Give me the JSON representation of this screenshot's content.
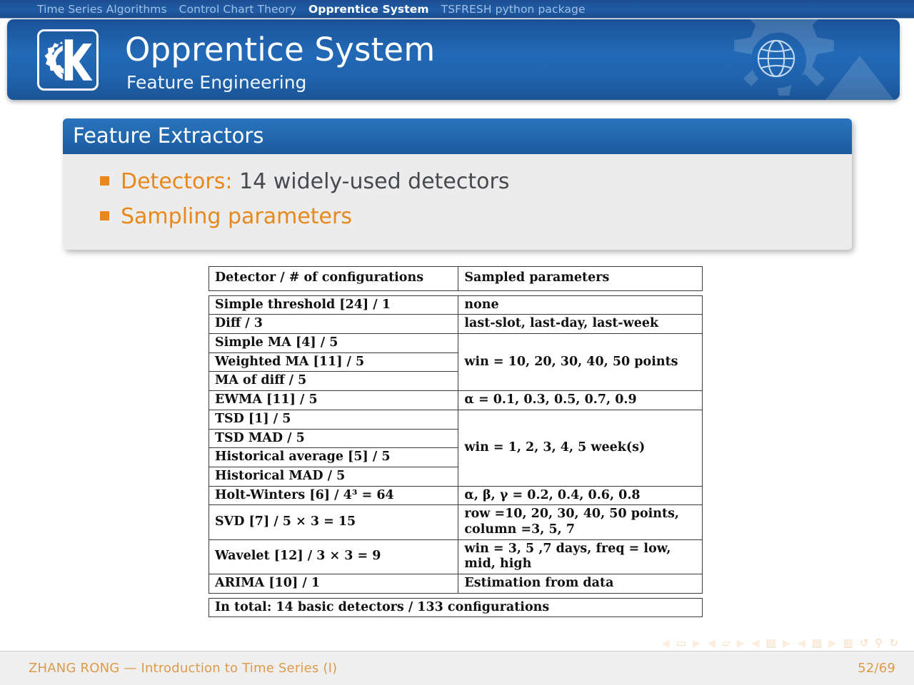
{
  "nav": {
    "items": [
      {
        "label": "Time Series Algorithms",
        "active": false
      },
      {
        "label": "Control Chart Theory",
        "active": false
      },
      {
        "label": "Opprentice System",
        "active": true
      },
      {
        "label": "TSFRESH python package",
        "active": false
      }
    ]
  },
  "header": {
    "title": "Opprentice System",
    "subtitle": "Feature Engineering",
    "logo_icon": "kde-k-gear-logo-icon",
    "globe_icon": "globe-icon"
  },
  "block": {
    "title": "Feature Extractors",
    "bullets": [
      {
        "accent": "Detectors:",
        "plain": " 14 widely-used detectors"
      },
      {
        "accent": "Sampling parameters",
        "plain": ""
      }
    ]
  },
  "table": {
    "headers": [
      "Detector / # of configurations",
      "Sampled parameters"
    ],
    "rows": [
      {
        "detector": "Simple threshold [24] / 1",
        "params": "none",
        "span": 1
      },
      {
        "detector": "Diff / 3",
        "params": "last-slot, last-day, last-week",
        "span": 1
      },
      {
        "detector": "Simple MA [4] / 5",
        "params": "win = 10, 20, 30, 40, 50 points",
        "span": 3
      },
      {
        "detector": "Weighted MA [11] / 5",
        "params": null,
        "span": 0
      },
      {
        "detector": "MA of diff / 5",
        "params": null,
        "span": 0
      },
      {
        "detector": "EWMA [11] / 5",
        "params": "α = 0.1, 0.3, 0.5, 0.7, 0.9",
        "span": 1
      },
      {
        "detector": "TSD [1] / 5",
        "params": "win = 1, 2, 3, 4, 5 week(s)",
        "span": 4
      },
      {
        "detector": "TSD MAD / 5",
        "params": null,
        "span": 0
      },
      {
        "detector": "Historical average [5] / 5",
        "params": null,
        "span": 0
      },
      {
        "detector": "Historical MAD / 5",
        "params": null,
        "span": 0
      },
      {
        "detector": "Holt-Winters [6] / 4³ = 64",
        "params": "α, β, γ = 0.2, 0.4, 0.6, 0.8",
        "span": 1
      },
      {
        "detector": "SVD [7] / 5 × 3 = 15",
        "params": "row =10, 20, 30, 40, 50 points, column =3, 5, 7",
        "span": 1
      },
      {
        "detector": "Wavelet [12] / 3 × 3 = 9",
        "params": "win = 3, 5 ,7 days,      freq = low, mid, high",
        "span": 1
      },
      {
        "detector": "ARIMA [10] / 1",
        "params": "Estimation from data",
        "span": 1
      }
    ],
    "total_row": "In total: 14 basic detectors / 133 configurations"
  },
  "nav_symbols": [
    "nav-slide-prev-icon",
    "nav-slide-icon",
    "nav-slide-next-icon",
    "nav-frame-prev-icon",
    "nav-frame-icon",
    "nav-frame-next-icon",
    "nav-subsection-prev-icon",
    "nav-subsection-icon",
    "nav-subsection-next-icon",
    "nav-section-prev-icon",
    "nav-section-icon",
    "nav-section-next-icon",
    "nav-doc-icon",
    "nav-back-icon",
    "nav-search-icon",
    "nav-forward-icon"
  ],
  "footer": {
    "left": "ZHANG RONG — Introduction to Time Series (I)",
    "right": "52/69"
  },
  "colors": {
    "header_blue": "#1f63ad",
    "block_blue": "#2167ad",
    "accent_orange": "#e8881c",
    "footer_orange": "#dd9a4a",
    "body_gray": "#46494d",
    "block_body": "#ececec"
  }
}
